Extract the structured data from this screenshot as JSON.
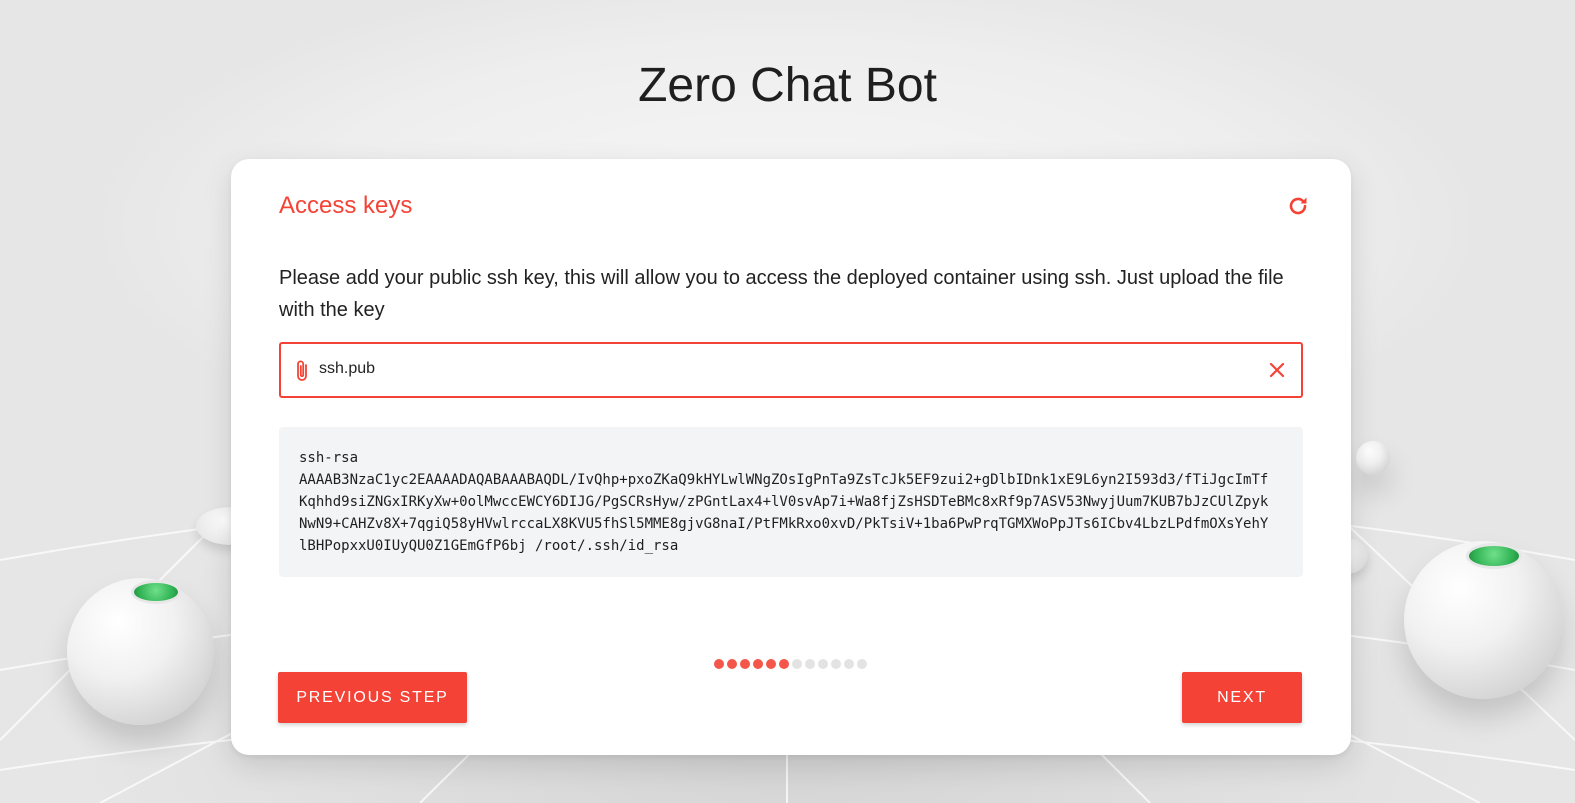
{
  "app": {
    "title": "Zero Chat Bot"
  },
  "card": {
    "title": "Access keys",
    "refresh_icon": "refresh-icon",
    "description": "Please add your public ssh key, this will allow you to access the deployed container using ssh. Just upload the file with the key"
  },
  "file_input": {
    "value": "ssh.pub",
    "attach_icon": "paperclip-icon",
    "clear_icon": "close-icon"
  },
  "ssh_key": {
    "lines": [
      "ssh-rsa",
      "AAAAB3NzaC1yc2EAAAADAQABAAABAQDL/IvQhp+pxoZKaQ9kHYLwlWNgZOsIgPnTa9ZsTcJk5EF9zui2+gDlbIDnk1xE9L6yn2I593d3/fTiJgcImTf",
      "Kqhhd9siZNGxIRKyXw+0olMwccEWCY6DIJG/PgSCRsHyw/zPGntLax4+lV0svAp7i+Wa8fjZsHSDTeBMc8xRf9p7ASV53NwyjUum7KUB7bJzCUlZpyk",
      "NwN9+CAHZv8X+7qgiQ58yHVwlrccaLX8KVU5fhSl5MME8gjvG8naI/PtFMkRxo0xvD/PkTsiV+1ba6PwPrqTGMXWoPpJTs6ICbv4LbzLPdfmOXsYehY",
      "lBHPopxxU0IUyQU0Z1GEmGfP6bj /root/.ssh/id_rsa"
    ]
  },
  "stepper": {
    "total_steps": 12,
    "completed_steps": 6,
    "active_color": "#f4574a",
    "inactive_color": "#e3e3e3"
  },
  "buttons": {
    "previous_label": "PREVIOUS STEP",
    "next_label": "NEXT"
  },
  "colors": {
    "accent": "#f44336",
    "title_text": "#1f1f1f",
    "key_box_bg": "#f3f4f6"
  }
}
